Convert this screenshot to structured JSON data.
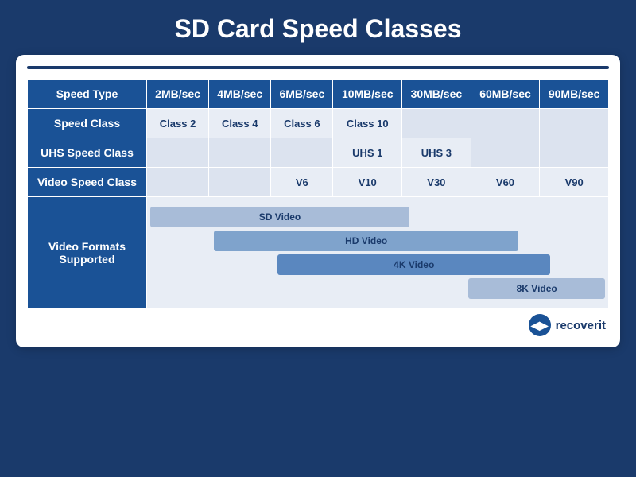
{
  "title": "SD Card Speed Classes",
  "table": {
    "speed_row_label": "Speed Type",
    "speed_class_label": "Speed Class",
    "uhs_label": "UHS Speed Class",
    "video_label": "Video Speed Class",
    "formats_label": "Video Formats\nSupported",
    "columns": [
      {
        "header": "2MB/sec",
        "speed_class": "Class 2",
        "uhs": "",
        "video": ""
      },
      {
        "header": "4MB/sec",
        "speed_class": "Class 4",
        "uhs": "",
        "video": ""
      },
      {
        "header": "6MB/sec",
        "speed_class": "Class 6",
        "uhs": "",
        "video": "V6"
      },
      {
        "header": "10MB/sec",
        "speed_class": "Class 10",
        "uhs": "UHS 1",
        "video": "V10"
      },
      {
        "header": "30MB/sec",
        "speed_class": "",
        "uhs": "UHS 3",
        "video": "V30"
      },
      {
        "header": "60MB/sec",
        "speed_class": "",
        "uhs": "",
        "video": "V60"
      },
      {
        "header": "90MB/sec",
        "speed_class": "",
        "uhs": "",
        "video": "V90"
      }
    ],
    "video_formats": [
      {
        "label": "SD Video",
        "start": 0,
        "span": 4
      },
      {
        "label": "HD Video",
        "start": 1,
        "span": 4
      },
      {
        "label": "4K Video",
        "start": 2,
        "span": 4
      },
      {
        "label": "8K Video",
        "start": 5,
        "span": 2
      }
    ]
  },
  "brand": {
    "logo": "◀▶",
    "name": "recoverit"
  }
}
